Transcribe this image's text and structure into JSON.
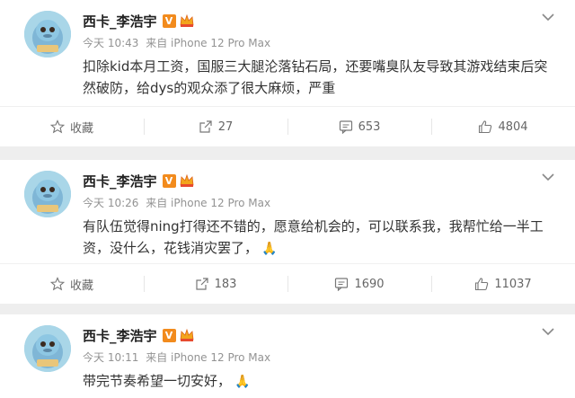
{
  "posts": [
    {
      "username": "西卡_李浩宇",
      "vip_mark": "V",
      "time": "今天 10:43",
      "source": "来自 iPhone 12 Pro Max",
      "text": "扣除kid本月工资，国服三大腿沦落钻石局，还要嘴臭队友导致其游戏结束后突然破防，给dys的观众添了很大麻烦，严重",
      "emoji": "",
      "favorite_label": "收藏",
      "repost_count": "27",
      "comment_count": "653",
      "like_count": "4804"
    },
    {
      "username": "西卡_李浩宇",
      "vip_mark": "V",
      "time": "今天 10:26",
      "source": "来自 iPhone 12 Pro Max",
      "text": "有队伍觉得ning打得还不错的，愿意给机会的，可以联系我，我帮忙给一半工资，没什么，花钱消灾罢了，",
      "emoji": "🙏",
      "favorite_label": "收藏",
      "repost_count": "183",
      "comment_count": "1690",
      "like_count": "11037"
    },
    {
      "username": "西卡_李浩宇",
      "vip_mark": "V",
      "time": "今天 10:11",
      "source": "来自 iPhone 12 Pro Max",
      "text": "带完节奏希望一切安好，",
      "emoji": "🙏"
    }
  ],
  "icons": {
    "more": "chevron-down-icon",
    "favorite": "star-icon",
    "repost": "share-arrow-icon",
    "comment": "comment-bubble-icon",
    "like": "thumbs-up-icon"
  },
  "colors": {
    "vip_badge": "#f28b1d",
    "meta_text": "#939393",
    "emoji": "#e0a527"
  }
}
